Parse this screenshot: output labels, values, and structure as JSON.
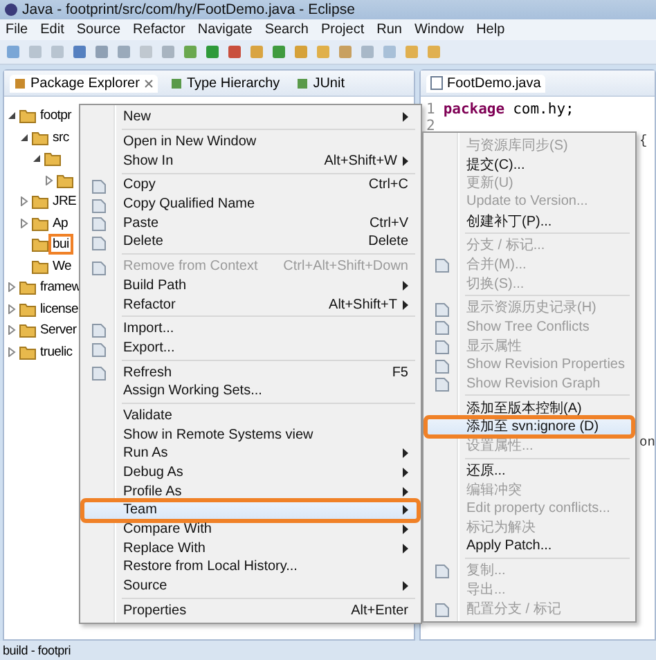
{
  "window": {
    "title": "Java - footprint/src/com/hy/FootDemo.java - Eclipse"
  },
  "menubar": [
    "File",
    "Edit",
    "Source",
    "Refactor",
    "Navigate",
    "Search",
    "Project",
    "Run",
    "Window",
    "Help"
  ],
  "left_panel": {
    "tabs": [
      {
        "label": "Package Explorer",
        "selected": true,
        "closable": true
      },
      {
        "label": "Type Hierarchy",
        "selected": false,
        "closable": false
      },
      {
        "label": "JUnit",
        "selected": false,
        "closable": false
      }
    ],
    "tree": [
      {
        "label": "footpr",
        "expanded": true,
        "children": [
          {
            "label": "src",
            "expanded": true,
            "children": [
              {
                "expanded": true,
                "children": [
                  {
                    "expanded": false
                  }
                ]
              }
            ]
          },
          {
            "label": "JRE",
            "expanded": false
          },
          {
            "label": "Ap",
            "expanded": false
          },
          {
            "label": "bui",
            "highlighted": true
          },
          {
            "label": "We"
          }
        ]
      },
      {
        "label": "framew",
        "expanded": false
      },
      {
        "label": "license",
        "expanded": false
      },
      {
        "label": "Server",
        "expanded": false
      },
      {
        "label": "truelic",
        "expanded": false
      }
    ]
  },
  "editor": {
    "tab": {
      "label": "FootDemo.java",
      "selected": true
    },
    "lines": [
      {
        "number": "1",
        "keyword": "package",
        "code": "com.hy;"
      },
      {
        "number": "2"
      }
    ],
    "fragments": [
      "{",
      "on"
    ]
  },
  "status_bar": {
    "text": "build - footpri"
  },
  "context_menu": [
    {
      "kind": "item",
      "label": "New",
      "submenu": true,
      "disabled": false,
      "selected": false,
      "highlighted": false,
      "icon": false
    },
    {
      "kind": "separator"
    },
    {
      "kind": "item",
      "label": "Open in New Window",
      "submenu": false,
      "disabled": false,
      "selected": false,
      "highlighted": false,
      "icon": false
    },
    {
      "kind": "item",
      "label": "Show In",
      "shortcut": "Alt+Shift+W",
      "submenu": true,
      "disabled": false,
      "selected": false,
      "highlighted": false,
      "icon": false
    },
    {
      "kind": "separator"
    },
    {
      "kind": "item",
      "label": "Copy",
      "shortcut": "Ctrl+C",
      "submenu": false,
      "disabled": false,
      "selected": false,
      "highlighted": false,
      "icon": true
    },
    {
      "kind": "item",
      "label": "Copy Qualified Name",
      "submenu": false,
      "disabled": false,
      "selected": false,
      "highlighted": false,
      "icon": true
    },
    {
      "kind": "item",
      "label": "Paste",
      "shortcut": "Ctrl+V",
      "submenu": false,
      "disabled": false,
      "selected": false,
      "highlighted": false,
      "icon": true
    },
    {
      "kind": "item",
      "label": "Delete",
      "shortcut": "Delete",
      "submenu": false,
      "disabled": false,
      "selected": false,
      "highlighted": false,
      "icon": true
    },
    {
      "kind": "separator"
    },
    {
      "kind": "item",
      "label": "Remove from Context",
      "shortcut": "Ctrl+Alt+Shift+Down",
      "submenu": false,
      "disabled": true,
      "selected": false,
      "highlighted": false,
      "icon": true
    },
    {
      "kind": "item",
      "label": "Build Path",
      "submenu": true,
      "disabled": false,
      "selected": false,
      "highlighted": false,
      "icon": false
    },
    {
      "kind": "item",
      "label": "Refactor",
      "shortcut": "Alt+Shift+T",
      "submenu": true,
      "disabled": false,
      "selected": false,
      "highlighted": false,
      "icon": false
    },
    {
      "kind": "separator"
    },
    {
      "kind": "item",
      "label": "Import...",
      "submenu": false,
      "disabled": false,
      "selected": false,
      "highlighted": false,
      "icon": true
    },
    {
      "kind": "item",
      "label": "Export...",
      "submenu": false,
      "disabled": false,
      "selected": false,
      "highlighted": false,
      "icon": true
    },
    {
      "kind": "separator"
    },
    {
      "kind": "item",
      "label": "Refresh",
      "shortcut": "F5",
      "submenu": false,
      "disabled": false,
      "selected": false,
      "highlighted": false,
      "icon": true
    },
    {
      "kind": "item",
      "label": "Assign Working Sets...",
      "submenu": false,
      "disabled": false,
      "selected": false,
      "highlighted": false,
      "icon": false
    },
    {
      "kind": "separator"
    },
    {
      "kind": "item",
      "label": "Validate",
      "submenu": false,
      "disabled": false,
      "selected": false,
      "highlighted": false,
      "icon": false
    },
    {
      "kind": "item",
      "label": "Show in Remote Systems view",
      "submenu": false,
      "disabled": false,
      "selected": false,
      "highlighted": false,
      "icon": false
    },
    {
      "kind": "item",
      "label": "Run As",
      "submenu": true,
      "disabled": false,
      "selected": false,
      "highlighted": false,
      "icon": false
    },
    {
      "kind": "item",
      "label": "Debug As",
      "submenu": true,
      "disabled": false,
      "selected": false,
      "highlighted": false,
      "icon": false
    },
    {
      "kind": "item",
      "label": "Profile As",
      "submenu": true,
      "disabled": false,
      "selected": false,
      "highlighted": false,
      "icon": false
    },
    {
      "kind": "item",
      "label": "Team",
      "submenu": true,
      "disabled": false,
      "selected": true,
      "highlighted": true,
      "icon": false
    },
    {
      "kind": "item",
      "label": "Compare With",
      "submenu": true,
      "disabled": false,
      "selected": false,
      "highlighted": false,
      "icon": false
    },
    {
      "kind": "item",
      "label": "Replace With",
      "submenu": true,
      "disabled": false,
      "selected": false,
      "highlighted": false,
      "icon": false
    },
    {
      "kind": "item",
      "label": "Restore from Local History...",
      "submenu": false,
      "disabled": false,
      "selected": false,
      "highlighted": false,
      "icon": false
    },
    {
      "kind": "item",
      "label": "Source",
      "submenu": true,
      "disabled": false,
      "selected": false,
      "highlighted": false,
      "icon": false
    },
    {
      "kind": "separator"
    },
    {
      "kind": "item",
      "label": "Properties",
      "shortcut": "Alt+Enter",
      "submenu": false,
      "disabled": false,
      "selected": false,
      "highlighted": false,
      "icon": false
    }
  ],
  "team_submenu": [
    {
      "kind": "item",
      "label": "与资源库同步(S)",
      "disabled": true,
      "selected": false,
      "highlighted": false,
      "icon": false
    },
    {
      "kind": "item",
      "label": "提交(C)...",
      "disabled": false,
      "selected": false,
      "highlighted": false,
      "icon": false
    },
    {
      "kind": "item",
      "label": "更新(U)",
      "disabled": true,
      "selected": false,
      "highlighted": false,
      "icon": false
    },
    {
      "kind": "item",
      "label": "Update to Version...",
      "disabled": true,
      "selected": false,
      "highlighted": false,
      "icon": false
    },
    {
      "kind": "item",
      "label": "创建补丁(P)...",
      "disabled": false,
      "selected": false,
      "highlighted": false,
      "icon": false
    },
    {
      "kind": "separator"
    },
    {
      "kind": "item",
      "label": "分支 / 标记...",
      "disabled": true,
      "selected": false,
      "highlighted": false,
      "icon": false
    },
    {
      "kind": "item",
      "label": "合并(M)...",
      "disabled": true,
      "selected": false,
      "highlighted": false,
      "icon": true
    },
    {
      "kind": "item",
      "label": "切换(S)...",
      "disabled": true,
      "selected": false,
      "highlighted": false,
      "icon": false
    },
    {
      "kind": "separator"
    },
    {
      "kind": "item",
      "label": "显示资源历史记录(H)",
      "disabled": true,
      "selected": false,
      "highlighted": false,
      "icon": true
    },
    {
      "kind": "item",
      "label": "Show Tree Conflicts",
      "disabled": true,
      "selected": false,
      "highlighted": false,
      "icon": true
    },
    {
      "kind": "item",
      "label": "显示属性",
      "disabled": true,
      "selected": false,
      "highlighted": false,
      "icon": true
    },
    {
      "kind": "item",
      "label": "Show Revision Properties",
      "disabled": true,
      "selected": false,
      "highlighted": false,
      "icon": true
    },
    {
      "kind": "item",
      "label": "Show Revision Graph",
      "disabled": true,
      "selected": false,
      "highlighted": false,
      "icon": true
    },
    {
      "kind": "separator"
    },
    {
      "kind": "item",
      "label": "添加至版本控制(A)",
      "disabled": false,
      "selected": false,
      "highlighted": false,
      "icon": false
    },
    {
      "kind": "item",
      "label": "添加至 svn:ignore (D)",
      "disabled": false,
      "selected": true,
      "highlighted": true,
      "icon": false
    },
    {
      "kind": "item",
      "label": "设置属性...",
      "disabled": true,
      "selected": false,
      "highlighted": false,
      "icon": false
    },
    {
      "kind": "separator"
    },
    {
      "kind": "item",
      "label": "还原...",
      "disabled": false,
      "selected": false,
      "highlighted": false,
      "icon": false
    },
    {
      "kind": "item",
      "label": "编辑冲突",
      "disabled": true,
      "selected": false,
      "highlighted": false,
      "icon": false
    },
    {
      "kind": "item",
      "label": "Edit property conflicts...",
      "disabled": true,
      "selected": false,
      "highlighted": false,
      "icon": false
    },
    {
      "kind": "item",
      "label": "标记为解决",
      "disabled": true,
      "selected": false,
      "highlighted": false,
      "icon": false
    },
    {
      "kind": "item",
      "label": "Apply Patch...",
      "disabled": false,
      "selected": false,
      "highlighted": false,
      "icon": false
    },
    {
      "kind": "separator"
    },
    {
      "kind": "item",
      "label": "复制...",
      "disabled": true,
      "selected": false,
      "highlighted": false,
      "icon": true
    },
    {
      "kind": "item",
      "label": "导出...",
      "disabled": true,
      "selected": false,
      "highlighted": false,
      "icon": false
    },
    {
      "kind": "item",
      "label": "配置分支 / 标记",
      "disabled": true,
      "selected": false,
      "highlighted": false,
      "icon": true
    }
  ]
}
